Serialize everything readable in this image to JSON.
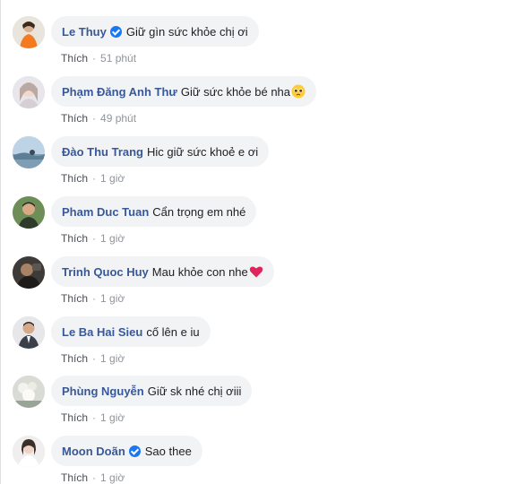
{
  "comments": [
    {
      "author": "Le Thuy",
      "verified": true,
      "text": "Giữ gìn sức khỏe chị ơi",
      "like": "Thích",
      "time": "51 phút",
      "avatar": "avatar-woman-orange"
    },
    {
      "author": "Phạm Đăng Anh Thư",
      "verified": false,
      "text": "Giữ sức khỏe bé nha",
      "emoji": "pleading-face-emoji",
      "like": "Thích",
      "time": "49 phút",
      "avatar": "avatar-girl-light"
    },
    {
      "author": "Đào Thu Trang",
      "verified": false,
      "text": "Hic giữ sức khoẻ e ơi",
      "like": "Thích",
      "time": "1 giờ",
      "avatar": "avatar-landscape-blue"
    },
    {
      "author": "Pham Duc Tuan",
      "verified": false,
      "text": "Cẩn trọng em nhé",
      "like": "Thích",
      "time": "1 giờ",
      "avatar": "avatar-man-green"
    },
    {
      "author": "Trinh Quoc Huy",
      "verified": false,
      "text": "Mau khỏe con nhe",
      "emoji": "red-heart-emoji",
      "like": "Thích",
      "time": "1 giờ",
      "avatar": "avatar-dark-photo"
    },
    {
      "author": "Le Ba Hai Sieu",
      "verified": false,
      "text": "cố lên e iu",
      "like": "Thích",
      "time": "1 giờ",
      "avatar": "avatar-man-suit"
    },
    {
      "author": "Phùng Nguyễn",
      "verified": false,
      "text": "Giữ sk nhé chị ơiii",
      "like": "Thích",
      "time": "1 giờ",
      "avatar": "avatar-flowers-light"
    },
    {
      "author": "Moon Doãn",
      "verified": true,
      "text": "Sao thee",
      "like": "Thích",
      "time": "1 giờ",
      "avatar": "avatar-woman-white"
    }
  ],
  "colors": {
    "author": "#385898",
    "bubble": "#f2f3f5",
    "meta": "#90949c",
    "verified": "#1877f2"
  }
}
